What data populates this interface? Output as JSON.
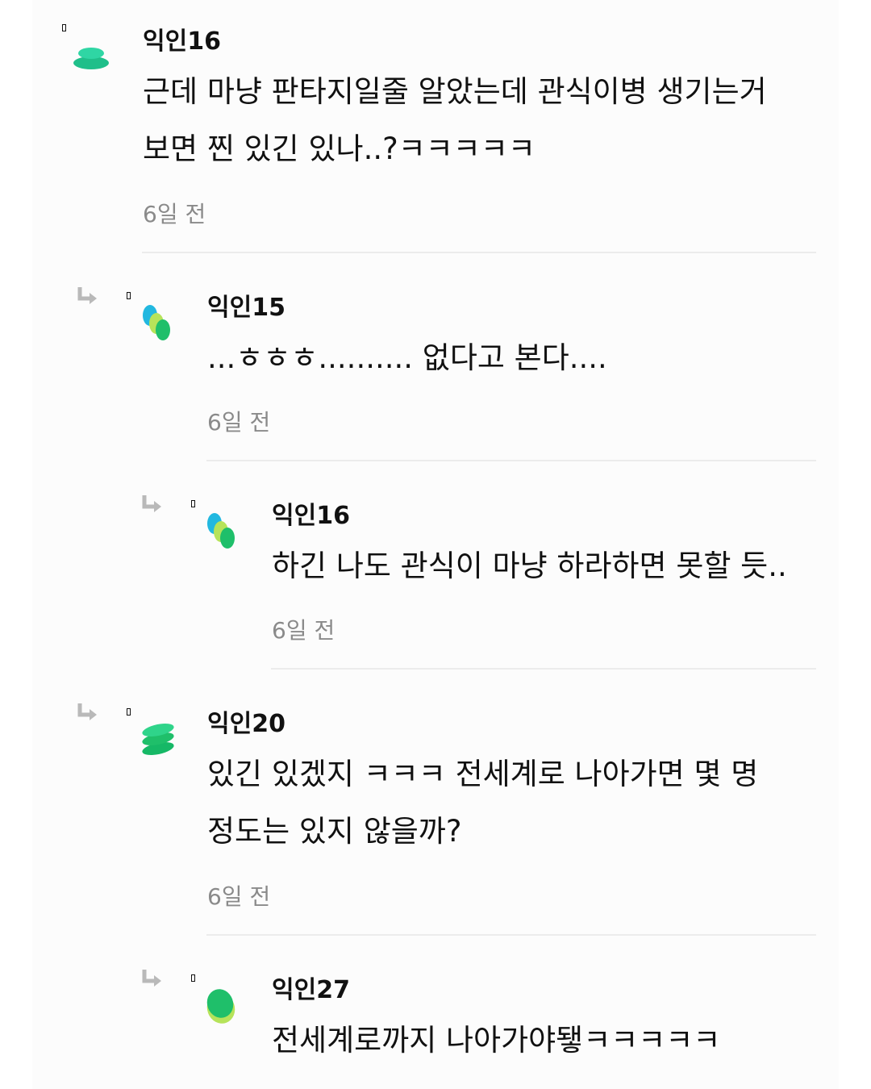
{
  "comments": [
    {
      "nickname": "익인16",
      "text": "근데 마냥 판타지일줄 알았는데 관식이병 생기는거 보면 찐 있긴 있나..?ㅋㅋㅋㅋㅋ",
      "time": "6일 전",
      "avatar": "stack-icon"
    },
    {
      "nickname": "익인15",
      "text": "...ㅎㅎㅎ.......... 없다고 본다....",
      "time": "6일 전",
      "avatar": "dots-icon"
    },
    {
      "nickname": "익인16",
      "text": "하긴 나도 관식이 마냥 하라하면 못할 듯..",
      "time": "6일 전",
      "avatar": "dots-icon"
    },
    {
      "nickname": "익인20",
      "text": "있긴 있겠지 ㅋㅋㅋ 전세계로 나아가면 몇 명 정도는 있지 않을까?",
      "time": "6일 전",
      "avatar": "layers-icon"
    },
    {
      "nickname": "익인27",
      "text": "전세계로까지 나아가야됗ㅋㅋㅋㅋㅋ",
      "time": "",
      "avatar": "blob-icon"
    }
  ],
  "colors": {
    "teal": "#2fd6a4",
    "green": "#1fbf6a",
    "cyan": "#22b8e0",
    "lime": "#b6e35a",
    "time": "#8a8a8a"
  }
}
